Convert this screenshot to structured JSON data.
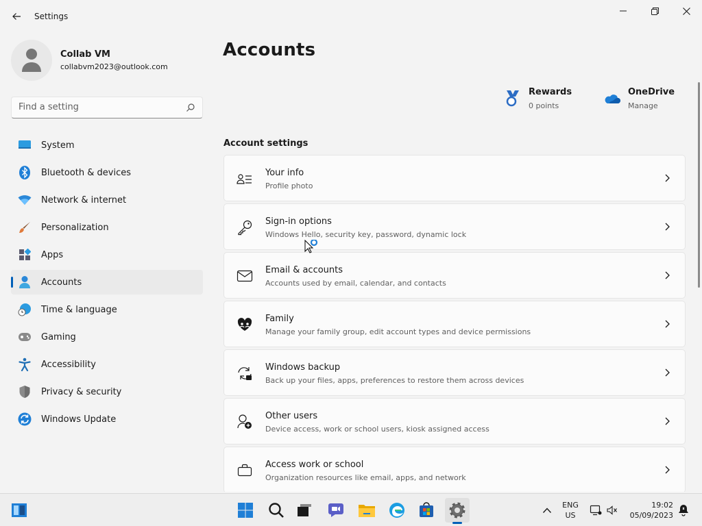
{
  "window": {
    "title": "Settings",
    "back_icon": "arrow-left-icon",
    "controls": [
      "minimize-icon",
      "maximize-icon",
      "close-icon"
    ]
  },
  "profile": {
    "name": "Collab VM",
    "email": "collabvm2023@outlook.com"
  },
  "search": {
    "placeholder": "Find a setting"
  },
  "sidebar": {
    "items": [
      {
        "label": "System",
        "icon": "monitor-icon"
      },
      {
        "label": "Bluetooth & devices",
        "icon": "bluetooth-icon"
      },
      {
        "label": "Network & internet",
        "icon": "wifi-icon"
      },
      {
        "label": "Personalization",
        "icon": "paintbrush-icon"
      },
      {
        "label": "Apps",
        "icon": "apps-icon"
      },
      {
        "label": "Accounts",
        "icon": "person-icon",
        "selected": true
      },
      {
        "label": "Time & language",
        "icon": "globe-clock-icon"
      },
      {
        "label": "Gaming",
        "icon": "gamepad-icon"
      },
      {
        "label": "Accessibility",
        "icon": "accessibility-icon"
      },
      {
        "label": "Privacy & security",
        "icon": "shield-icon"
      },
      {
        "label": "Windows Update",
        "icon": "update-icon"
      }
    ]
  },
  "main": {
    "title": "Accounts",
    "promos": [
      {
        "title": "Rewards",
        "subtitle": "0 points",
        "icon": "rewards-medal-icon"
      },
      {
        "title": "OneDrive",
        "subtitle": "Manage",
        "icon": "onedrive-cloud-icon"
      }
    ],
    "section_title": "Account settings",
    "cards": [
      {
        "title": "Your info",
        "desc": "Profile photo",
        "icon": "contact-card-icon"
      },
      {
        "title": "Sign-in options",
        "desc": "Windows Hello, security key, password, dynamic lock",
        "icon": "key-icon"
      },
      {
        "title": "Email & accounts",
        "desc": "Accounts used by email, calendar, and contacts",
        "icon": "mail-icon"
      },
      {
        "title": "Family",
        "desc": "Manage your family group, edit account types and device permissions",
        "icon": "family-heart-icon"
      },
      {
        "title": "Windows backup",
        "desc": "Back up your files, apps, preferences to restore them across devices",
        "icon": "backup-icon"
      },
      {
        "title": "Other users",
        "desc": "Device access, work or school users, kiosk assigned access",
        "icon": "add-person-icon"
      },
      {
        "title": "Access work or school",
        "desc": "Organization resources like email, apps, and network",
        "icon": "briefcase-icon"
      }
    ]
  },
  "taskbar": {
    "apps": [
      "widgets-icon",
      "start-icon",
      "search-icon",
      "task-view-icon",
      "chat-icon",
      "file-explorer-icon",
      "edge-icon",
      "store-icon",
      "settings-icon"
    ],
    "active_app": "settings-icon",
    "lang_line1": "ENG",
    "lang_line2": "US",
    "time": "19:02",
    "date": "05/09/2023"
  },
  "colors": {
    "accent": "#005fb8",
    "background": "#f3f3f3",
    "card": "#fbfbfb"
  }
}
